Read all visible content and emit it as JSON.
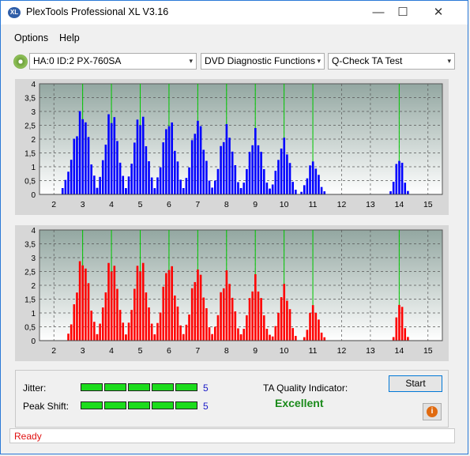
{
  "window": {
    "title": "PlexTools Professional XL V3.16",
    "app_icon_label": "XL",
    "minimize_glyph": "—",
    "maximize_glyph": "☐",
    "close_glyph": "✕"
  },
  "menu": [
    {
      "label": "Options"
    },
    {
      "label": "Help"
    }
  ],
  "toolbar": {
    "drive": "HA:0 ID:2  PX-760SA",
    "function": "DVD Diagnostic Functions",
    "test": "Q-Check TA Test",
    "arrow_glyph": "▾"
  },
  "chart_data": [
    {
      "type": "bar",
      "name": "top-chart",
      "color": "#0000ff",
      "ylim": [
        0,
        4
      ],
      "xlim": [
        1.5,
        15.5
      ],
      "x_ticks": [
        "2",
        "3",
        "4",
        "5",
        "6",
        "7",
        "8",
        "9",
        "10",
        "11",
        "12",
        "13",
        "14",
        "15"
      ],
      "y_ticks": [
        "0",
        "0,5",
        "1",
        "1,5",
        "2",
        "2,5",
        "3",
        "3,5",
        "4"
      ],
      "grid": true,
      "green_markers_x": [
        3,
        4,
        5,
        6,
        7,
        8,
        9,
        10,
        11,
        14
      ],
      "peaks": [
        {
          "x": 3,
          "height": 3.2,
          "left": 0.7,
          "right": 0.5
        },
        {
          "x": 4,
          "height": 3.2,
          "left": 0.5,
          "right": 0.5
        },
        {
          "x": 5,
          "height": 3.1,
          "left": 0.5,
          "right": 0.5
        },
        {
          "x": 6,
          "height": 2.9,
          "left": 0.5,
          "right": 0.5
        },
        {
          "x": 7,
          "height": 2.9,
          "left": 0.5,
          "right": 0.5
        },
        {
          "x": 8,
          "height": 2.6,
          "left": 0.5,
          "right": 0.5
        },
        {
          "x": 9,
          "height": 2.4,
          "left": 0.5,
          "right": 0.5
        },
        {
          "x": 10,
          "height": 2.1,
          "left": 0.5,
          "right": 0.4
        },
        {
          "x": 11,
          "height": 1.3,
          "left": 0.4,
          "right": 0.4
        },
        {
          "x": 14,
          "height": 1.5,
          "left": 0.3,
          "right": 0.3
        }
      ]
    },
    {
      "type": "bar",
      "name": "bottom-chart",
      "color": "#ff0000",
      "ylim": [
        0,
        4
      ],
      "xlim": [
        1.5,
        15.5
      ],
      "x_ticks": [
        "2",
        "3",
        "4",
        "5",
        "6",
        "7",
        "8",
        "9",
        "10",
        "11",
        "12",
        "13",
        "14",
        "15"
      ],
      "y_ticks": [
        "0",
        "0,5",
        "1",
        "1,5",
        "2",
        "2,5",
        "3",
        "3,5",
        "4"
      ],
      "grid": true,
      "green_markers_x": [
        3,
        4,
        5,
        6,
        7,
        8,
        9,
        10,
        11,
        14
      ],
      "peaks": [
        {
          "x": 3,
          "height": 3.2,
          "left": 0.5,
          "right": 0.5
        },
        {
          "x": 4,
          "height": 3.1,
          "left": 0.5,
          "right": 0.5
        },
        {
          "x": 5,
          "height": 3.1,
          "left": 0.5,
          "right": 0.5
        },
        {
          "x": 6,
          "height": 3.0,
          "left": 0.5,
          "right": 0.5
        },
        {
          "x": 7,
          "height": 2.8,
          "left": 0.5,
          "right": 0.5
        },
        {
          "x": 8,
          "height": 2.6,
          "left": 0.5,
          "right": 0.5
        },
        {
          "x": 9,
          "height": 2.4,
          "left": 0.5,
          "right": 0.5
        },
        {
          "x": 10,
          "height": 2.1,
          "left": 0.4,
          "right": 0.4
        },
        {
          "x": 11,
          "height": 1.4,
          "left": 0.3,
          "right": 0.4
        },
        {
          "x": 14,
          "height": 1.6,
          "left": 0.2,
          "right": 0.3
        }
      ]
    }
  ],
  "panel": {
    "jitter_label": "Jitter:",
    "jitter_value": "5",
    "jitter_level": 5,
    "jitter_max": 5,
    "peak_shift_label": "Peak Shift:",
    "peak_shift_value": "5",
    "peak_shift_level": 5,
    "peak_shift_max": 5,
    "ta_label": "TA Quality Indicator:",
    "ta_value": "Excellent",
    "start_label": "Start",
    "info_glyph": "i"
  },
  "status": {
    "text": "Ready"
  },
  "colors": {
    "title_accent": "#2b79d7",
    "marker_green": "#00c800",
    "meter_green": "#1cdc1c",
    "quality_green": "#1a8a1a",
    "status_red": "#e01010"
  }
}
